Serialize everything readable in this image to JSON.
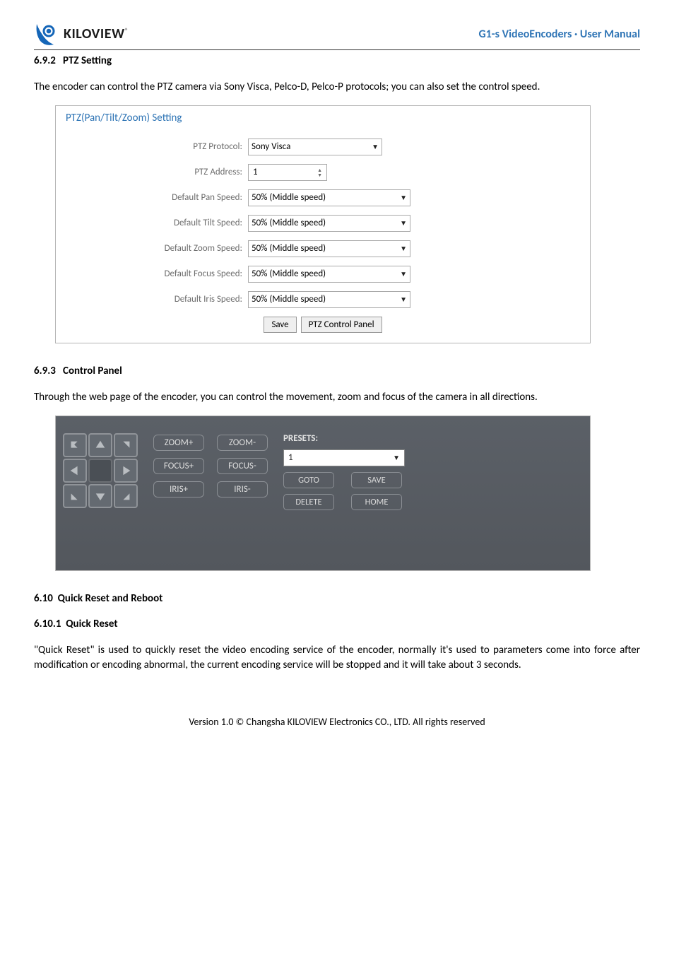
{
  "header": {
    "logo_text": "KILOVIEW",
    "doc_title": "G1-s VideoEncoders · User Manual"
  },
  "sections": {
    "ptz_setting": {
      "number": "6.9.2",
      "title": "PTZ Setting",
      "body": "The encoder can control the PTZ camera via Sony Visca, Pelco-D, Pelco-P protocols; you can also set the control speed."
    },
    "control_panel": {
      "number": "6.9.3",
      "title": "Control Panel",
      "body": "Through the web page of the encoder, you can control the movement, zoom and focus of the camera in all directions."
    },
    "quick_reset_reboot": {
      "number": "6.10",
      "title": "Quick Reset and Reboot"
    },
    "quick_reset": {
      "number": "6.10.1",
      "title": "Quick Reset",
      "body": "\"Quick Reset\" is used to quickly reset the video encoding service of the encoder, normally it's used to parameters come into force after modification or encoding abnormal, the current encoding service will be stopped and it will take about 3 seconds."
    }
  },
  "ptz_form": {
    "panel_title": "PTZ(Pan/Tilt/Zoom) Setting",
    "labels": {
      "protocol": "PTZ Protocol:",
      "address": "PTZ Address:",
      "pan": "Default Pan Speed:",
      "tilt": "Default Tilt Speed:",
      "zoom": "Default Zoom Speed:",
      "focus": "Default Focus Speed:",
      "iris": "Default Iris Speed:"
    },
    "values": {
      "protocol": "Sony Visca",
      "address": "1",
      "pan": "50% (Middle speed)",
      "tilt": "50% (Middle speed)",
      "zoom": "50% (Middle speed)",
      "focus": "50% (Middle speed)",
      "iris": "50% (Middle speed)"
    },
    "buttons": {
      "save": "Save",
      "panel": "PTZ Control Panel"
    }
  },
  "control_panel_ui": {
    "zoom_plus": "ZOOM+",
    "zoom_minus": "ZOOM-",
    "focus_plus": "FOCUS+",
    "focus_minus": "FOCUS-",
    "iris_plus": "IRIS+",
    "iris_minus": "IRIS-",
    "presets_label": "PRESETS:",
    "presets_value": "1",
    "goto": "GOTO",
    "save": "SAVE",
    "delete": "DELETE",
    "home": "HOME"
  },
  "footer": "Version 1.0 © Changsha KILOVIEW Electronics CO., LTD. All rights reserved"
}
